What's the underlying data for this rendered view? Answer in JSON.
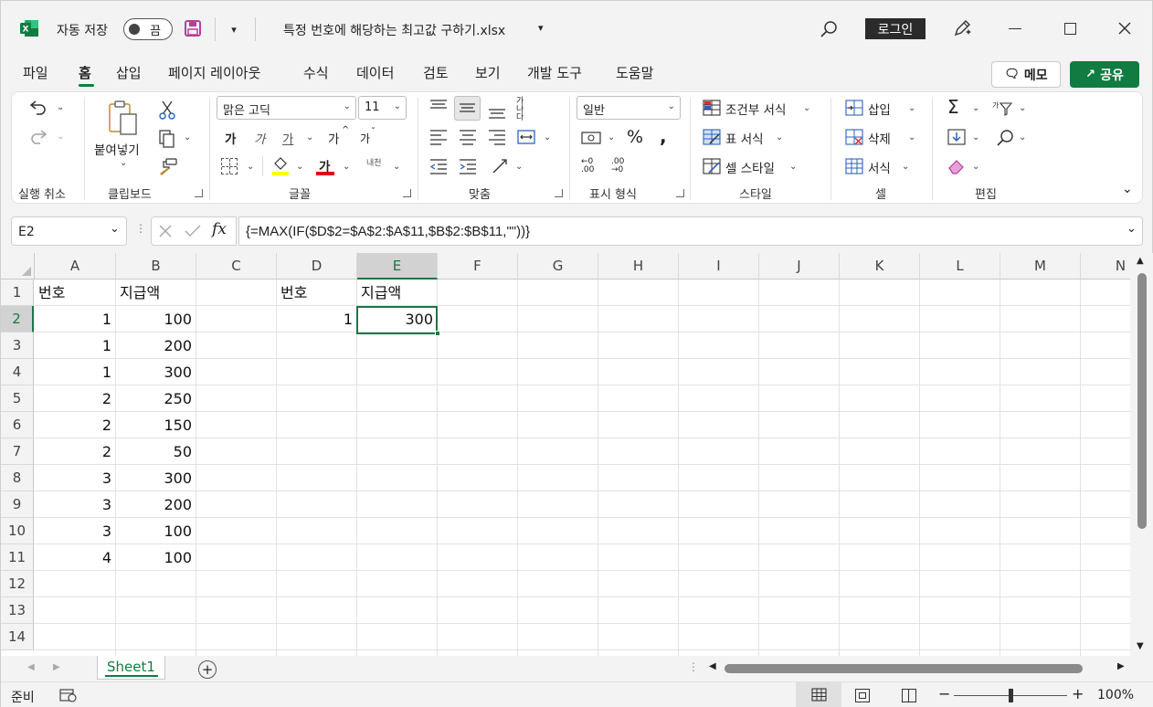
{
  "titlebar": {
    "autosave_label": "자동 저장",
    "autosave_state": "끔",
    "file_name": "특정 번호에 해당하는 최고값 구하기.xlsx",
    "login_label": "로그인"
  },
  "tabs": [
    "파일",
    "홈",
    "삽입",
    "페이지 레이아웃",
    "수식",
    "데이터",
    "검토",
    "보기",
    "개발 도구",
    "도움말"
  ],
  "active_tab": "홈",
  "actions": {
    "memo": "메모",
    "share": "공유"
  },
  "ribbon": {
    "undo_group": "실행 취소",
    "clipboard": {
      "paste": "붙여넣기",
      "label": "클립보드"
    },
    "font": {
      "name": "맑은 고딕",
      "size": "11",
      "bold": "가",
      "italic": "가",
      "underline": "가",
      "grow": "가",
      "shrink": "가",
      "font_color": "가",
      "phonetic": "내천",
      "label": "글꼴"
    },
    "alignment": {
      "label": "맞춤",
      "wrap": "가나다"
    },
    "number": {
      "format": "일반",
      "label": "표시 형식"
    },
    "styles": {
      "conditional": "조건부 서식",
      "table": "표 서식",
      "cell_styles": "셀 스타일",
      "label": "스타일"
    },
    "cells": {
      "insert": "삽입",
      "delete": "삭제",
      "format": "서식",
      "label": "셀"
    },
    "editing": {
      "label": "편집"
    }
  },
  "formula_bar": {
    "name_box": "E2",
    "formula": "{=MAX(IF($D$2=$A$2:$A$11,$B$2:$B$11,\"\"))}"
  },
  "columns": [
    "A",
    "B",
    "C",
    "D",
    "E",
    "F",
    "G",
    "H",
    "I",
    "J",
    "K",
    "L",
    "M",
    "N"
  ],
  "rows": [
    "1",
    "2",
    "3",
    "4",
    "5",
    "6",
    "7",
    "8",
    "9",
    "10",
    "11",
    "12",
    "13",
    "14"
  ],
  "cells": {
    "A1": "번호",
    "B1": "지급액",
    "D1": "번호",
    "E1": "지급액",
    "A2": "1",
    "B2": "100",
    "D2": "1",
    "E2": "300",
    "A3": "1",
    "B3": "200",
    "A4": "1",
    "B4": "300",
    "A5": "2",
    "B5": "250",
    "A6": "2",
    "B6": "150",
    "A7": "2",
    "B7": "50",
    "A8": "3",
    "B8": "300",
    "A9": "3",
    "B9": "200",
    "A10": "3",
    "B10": "100",
    "A11": "4",
    "B11": "100"
  },
  "selected_cell": "E2",
  "sheet_tab": "Sheet1",
  "status": {
    "ready": "준비",
    "zoom": "100%"
  },
  "colors": {
    "excel_green": "#107c41",
    "selection": "#217346"
  }
}
